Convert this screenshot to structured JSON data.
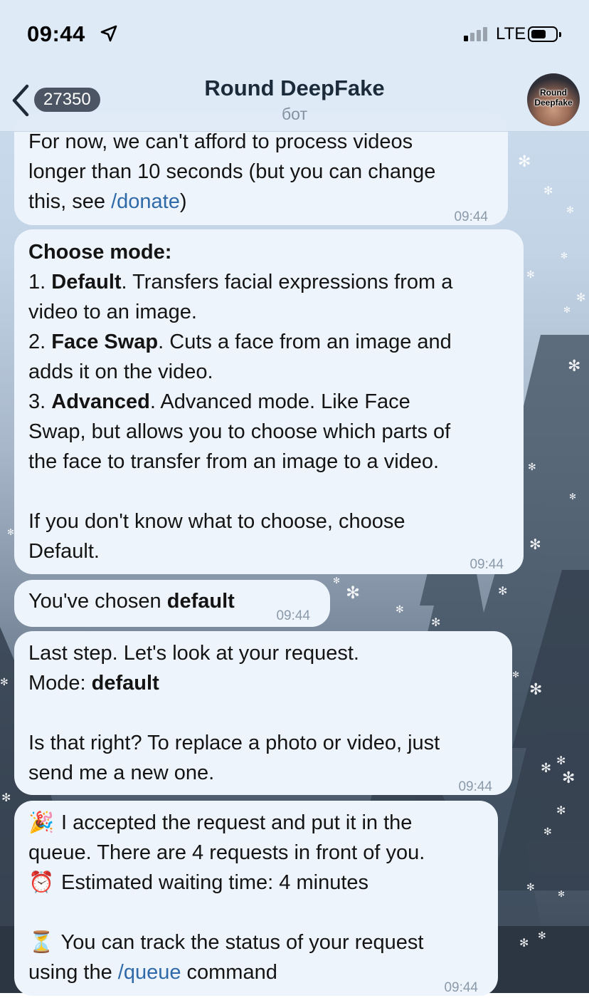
{
  "status": {
    "time": "09:44",
    "network": "LTE"
  },
  "header": {
    "unread_count": "27350",
    "title": "Round DeepFake",
    "subtitle": "бот",
    "avatar_line1": "Round",
    "avatar_line2": "Deepfake"
  },
  "messages": [
    {
      "id": "m1",
      "line1": "For now, we can't afford to process videos",
      "line2": "longer than 10 seconds (but you can change",
      "line3_pre": "this, see ",
      "line3_link": "/donate",
      "line3_post": ")",
      "time": "09:44"
    },
    {
      "id": "m2",
      "heading": "Choose mode:",
      "item1_num": "1. ",
      "item1_name": "Default",
      "item1_a": ". Transfers facial expressions from a",
      "item1_b": "video to an image.",
      "item2_num": "2. ",
      "item2_name": "Face Swap",
      "item2_a": ". Cuts a face from an image and",
      "item2_b": "adds it on the video.",
      "item3_num": "3. ",
      "item3_name": "Advanced",
      "item3_a": ". Advanced mode. Like Face",
      "item3_b": "Swap, but allows you to choose which parts of",
      "item3_c": "the face to transfer from an image to a video.",
      "footer_a": "If you don't know what to choose, choose",
      "footer_b": "Default.",
      "time": "09:44"
    },
    {
      "id": "m3",
      "pre": "You've chosen ",
      "bold": "default",
      "time": "09:44"
    },
    {
      "id": "m4",
      "line1": "Last step. Let's look at your request.",
      "mode_label": "Mode: ",
      "mode_value": "default",
      "line3": "Is that right? To replace a photo or video, just",
      "line4": "send me a new one.",
      "time": "09:44"
    },
    {
      "id": "m5",
      "emoji1": "🎉",
      "line1": " I accepted the request and put it in the",
      "line2": "queue. There are 4 requests in front of you.",
      "emoji2": "⏰",
      "line3": " Estimated waiting time: 4 minutes",
      "emoji3": "⏳",
      "line4": " You can track the status of your request",
      "line5_pre": "using the ",
      "line5_link": "/queue",
      "line5_post": " command",
      "time": "09:44"
    }
  ]
}
